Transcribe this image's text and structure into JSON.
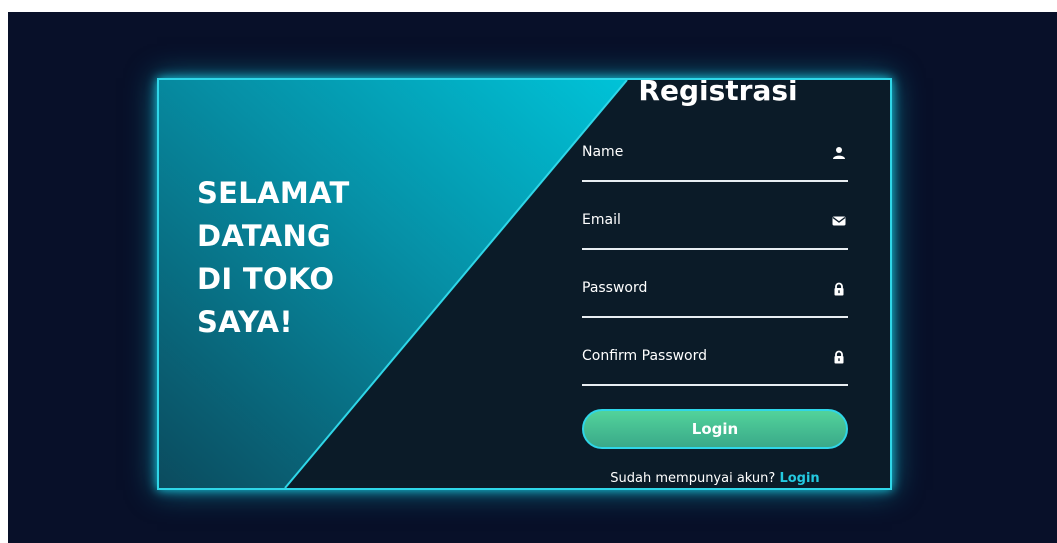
{
  "welcome": {
    "lines": [
      "SELAMAT",
      "DATANG",
      "DI TOKO",
      "SAYA!"
    ]
  },
  "form": {
    "title": "Registrasi",
    "fields": [
      {
        "label": "Name",
        "icon": "user-icon"
      },
      {
        "label": "Email",
        "icon": "envelope-icon"
      },
      {
        "label": "Password",
        "icon": "lock-icon"
      },
      {
        "label": "Confirm Password",
        "icon": "lock-icon"
      }
    ],
    "submit_label": "Login",
    "footer_text": "Sudah mempunyai akun?",
    "footer_link": "Login"
  },
  "colors": {
    "page_background": "#081029",
    "card_background": "#0b1b28",
    "accent": "#2fd6e8",
    "button_green": "#4cc996",
    "link": "#24c9e0"
  }
}
